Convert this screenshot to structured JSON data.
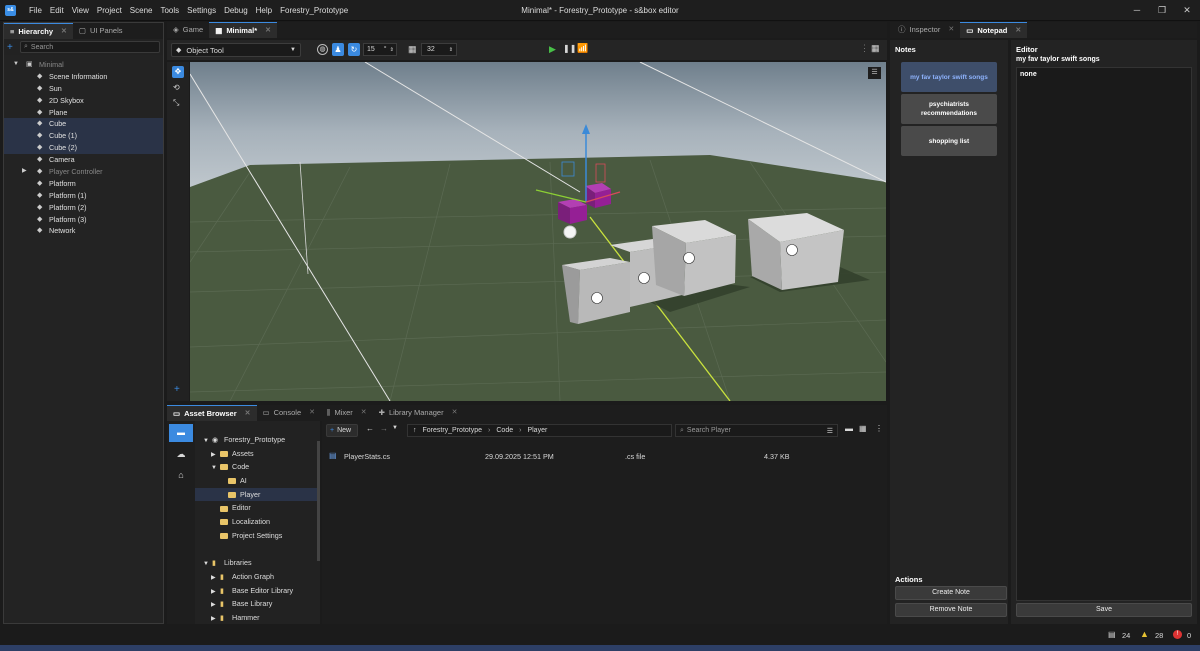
{
  "titlebar": {
    "logo": "s&",
    "menus": [
      "File",
      "Edit",
      "View",
      "Project",
      "Scene",
      "Tools",
      "Settings",
      "Debug",
      "Help",
      "Forestry_Prototype"
    ],
    "title": "Minimal* - Forestry_Prototype - s&box editor",
    "min": "─",
    "max": "❐",
    "close": "✕"
  },
  "hierarchy": {
    "tabs": [
      "Hierarchy",
      "UI Panels"
    ],
    "search_placeholder": "Search",
    "root": "Minimal",
    "items": [
      {
        "label": "Scene Information",
        "sel": false,
        "dim": false
      },
      {
        "label": "Sun",
        "sel": false,
        "dim": false
      },
      {
        "label": "2D Skybox",
        "sel": false,
        "dim": false
      },
      {
        "label": "Plane",
        "sel": false,
        "dim": false
      },
      {
        "label": "Cube",
        "sel": true,
        "dim": false
      },
      {
        "label": "Cube (1)",
        "sel": true,
        "dim": false
      },
      {
        "label": "Cube (2)",
        "sel": true,
        "dim": false
      },
      {
        "label": "Camera",
        "sel": false,
        "dim": false
      },
      {
        "label": "Player Controller",
        "sel": false,
        "dim": true
      },
      {
        "label": "Platform",
        "sel": false,
        "dim": false
      },
      {
        "label": "Platform (1)",
        "sel": false,
        "dim": false
      },
      {
        "label": "Platform (2)",
        "sel": false,
        "dim": false
      },
      {
        "label": "Platform (3)",
        "sel": false,
        "dim": false
      },
      {
        "label": "Network",
        "sel": false,
        "dim": false
      }
    ]
  },
  "scene": {
    "tabs": [
      "Game",
      "Minimal*"
    ],
    "tool": "Object Tool",
    "snap": "15",
    "snap_unit": "°",
    "grid": "32"
  },
  "asset": {
    "tabs": [
      "Asset Browser",
      "Console",
      "Mixer",
      "Library Manager"
    ],
    "new_label": "New",
    "breadcrumb": [
      "Forestry_Prototype",
      "Code",
      "Player"
    ],
    "search_placeholder": "Search Player",
    "tree": [
      {
        "label": "Forestry_Prototype",
        "indent": 0,
        "caret": "▼",
        "type": "proj"
      },
      {
        "label": "Assets",
        "indent": 1,
        "caret": "▶",
        "type": "folder"
      },
      {
        "label": "Code",
        "indent": 1,
        "caret": "▼",
        "type": "folder"
      },
      {
        "label": "AI",
        "indent": 2,
        "caret": "",
        "type": "folder"
      },
      {
        "label": "Player",
        "indent": 2,
        "caret": "",
        "type": "folder",
        "sel": true
      },
      {
        "label": "Editor",
        "indent": 1,
        "caret": "",
        "type": "folder"
      },
      {
        "label": "Localization",
        "indent": 1,
        "caret": "",
        "type": "folder"
      },
      {
        "label": "Project Settings",
        "indent": 1,
        "caret": "",
        "type": "folder"
      },
      {
        "label": "",
        "indent": 0,
        "caret": "",
        "type": "gap"
      },
      {
        "label": "Libraries",
        "indent": 0,
        "caret": "▼",
        "type": "lib"
      },
      {
        "label": "Action Graph",
        "indent": 1,
        "caret": "▶",
        "type": "lib"
      },
      {
        "label": "Base Editor Library",
        "indent": 1,
        "caret": "▶",
        "type": "lib"
      },
      {
        "label": "Base Library",
        "indent": 1,
        "caret": "▶",
        "type": "lib"
      },
      {
        "label": "Hammer",
        "indent": 1,
        "caret": "▶",
        "type": "lib"
      }
    ],
    "files": [
      {
        "name": "PlayerStats.cs",
        "date": "29.09.2025 12:51 PM",
        "type": ".cs file",
        "size": "4.37 KB"
      }
    ]
  },
  "right": {
    "tabs": [
      "Inspector",
      "Notepad"
    ],
    "notes_label": "Notes",
    "notes": [
      "my fav taylor swift songs",
      "psychiatrists recommendations",
      "shopping list"
    ],
    "actions_label": "Actions",
    "create": "Create Note",
    "remove": "Remove Note",
    "editor_label": "Editor",
    "editor_title": "my fav taylor swift songs",
    "editor_body": "none",
    "save": "Save"
  },
  "status": {
    "messages": "24",
    "warnings": "28",
    "errors": "0"
  },
  "colors": {
    "accent": "#3b8ae0",
    "ground": "#4a5a40",
    "sky": "#a9b4bd",
    "selected_note": "#8fb4ff"
  }
}
